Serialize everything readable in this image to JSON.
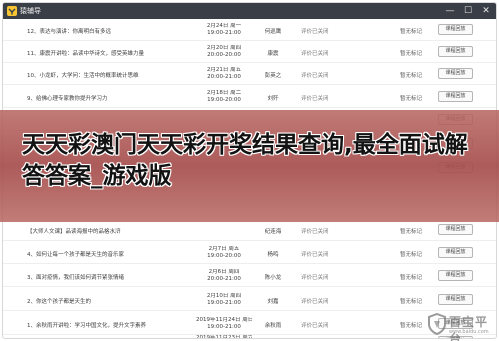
{
  "window": {
    "app_title": "猿辅导",
    "controls": {
      "minimize": "—",
      "maximize": "☐",
      "close": "✕"
    }
  },
  "lessons": [
    {
      "title": "12、表达与演讲：你离明白有多远",
      "date": "2月24日 周一",
      "time": "19:00-21:00",
      "teacher": "何巡鹰",
      "status": "评价已关闭",
      "review": "暂无标记",
      "replay": "课程回放"
    },
    {
      "title": "11、康震开讲啦：品读中华诗文，感受英雄力量",
      "date": "2月20日 周四",
      "time": "20:00-20:00",
      "teacher": "康震",
      "status": "评价已关闭",
      "review": "暂无标记",
      "replay": "课程回放"
    },
    {
      "title": "10、小龙虾，大学问：生活中的概率统计思维",
      "date": "2月21日 周五",
      "time": "20:00-21:00",
      "teacher": "彭英之",
      "status": "评价已关闭",
      "review": "暂无标记",
      "replay": "课程回放"
    },
    {
      "title": "9、给佛心理专家教你提升学习力",
      "date": "2月18日 周二",
      "time": "19:00-20:00",
      "teacher": "刘歼",
      "status": "评价已关闭",
      "review": "暂无标记",
      "replay": "课程回放"
    },
    {
      "title": "",
      "date": "",
      "time": "",
      "teacher": "",
      "status": "",
      "review": "",
      "replay": "课程回放"
    },
    {
      "title": "",
      "date": "",
      "time": "",
      "teacher": "",
      "status": "",
      "review": "",
      "replay": "课程回放"
    },
    {
      "title": "",
      "date": "",
      "time": "",
      "teacher": "",
      "status": "",
      "review": "",
      "replay": "课程回放"
    },
    {
      "title": "【大师人文课】品读海报中的品格水浒",
      "date": "",
      "time": "",
      "teacher": "纪连海",
      "status": "评价已关闭",
      "review": "暂无标记",
      "replay": "课程回放"
    },
    {
      "title": "4、如何让每一个孩子都是天生的音乐家",
      "date": "2月7日 周五",
      "time": "19:00-20:00",
      "teacher": "杨鸣",
      "status": "评价已关闭",
      "review": "暂无标记",
      "replay": "课程回放"
    },
    {
      "title": "3、面对疫情，我们该如何调节紧张情绪",
      "date": "2月6日 周四",
      "time": "20:00-21:00",
      "teacher": "陈小龙",
      "status": "评价已关闭",
      "review": "暂无标记",
      "replay": "课程回放"
    },
    {
      "title": "2、你这个孩子都是天生的",
      "date": "2月10日 周四",
      "time": "19:00-21:00",
      "teacher": "刘嘉",
      "status": "评价已关闭",
      "review": "暂无标记",
      "replay": "课程回放"
    },
    {
      "title": "1、余秋雨开讲啦：学习中国文化，提升文字素养",
      "date": "2019年11月24日 周日",
      "time": "19:00-21:00",
      "teacher": "余秋雨",
      "status": "评价已关闭",
      "review": "暂无标记",
      "replay": "课程回放"
    },
    {
      "title": "",
      "date": "2019年11月23日 周六",
      "time": "",
      "teacher": "纪连海",
      "status": "评价已关闭",
      "review": "暂无标记",
      "replay": "课程回放"
    }
  ],
  "banner": {
    "text": "天天彩澳门天天彩开奖结果查询,最全面试解答答案_游戏版"
  },
  "watermark": {
    "name": "百宝平台",
    "url": "www.baidu.com",
    "color": "#8a8a8a"
  },
  "colors": {
    "titlebar": "#3a3f47",
    "banner": "#a64f4e",
    "row_border": "#eeeeee"
  }
}
